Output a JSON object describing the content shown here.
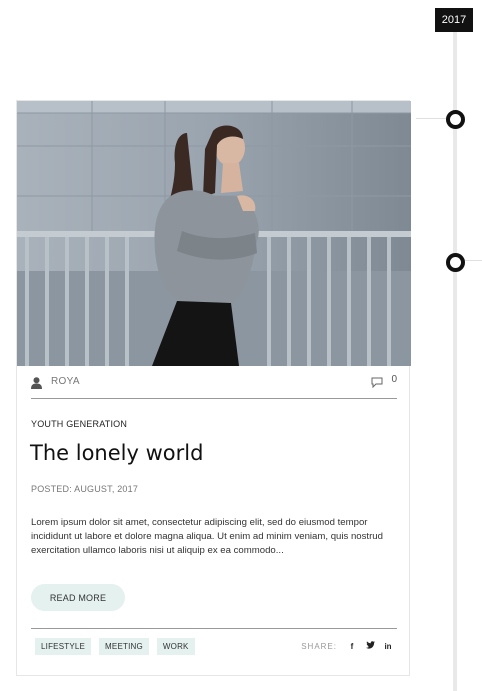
{
  "timeline": {
    "year": "2017"
  },
  "post": {
    "author": "ROYA",
    "comment_count": "0",
    "category": "YOUTH GENERATION",
    "title": "The lonely world",
    "posted": "POSTED: AUGUST, 2017",
    "excerpt": "Lorem ipsum dolor sit amet, consectetur adipiscing elit, sed do eiusmod tempor incididunt ut labore et dolore magna aliqua. Ut enim ad minim veniam, quis nostrud exercitation ullamco laboris nisi ut aliquip ex ea commodo...",
    "read_more": "READ MORE",
    "tags": [
      "LIFESTYLE",
      "MEETING",
      "WORK"
    ],
    "share_label": "SHARE:",
    "social": {
      "facebook": "f",
      "twitter": "🐦",
      "linkedin": "in"
    }
  },
  "icons": {
    "author": "user-icon",
    "comments": "comment-icon"
  },
  "colors": {
    "badge": "#111111",
    "tag_bg": "#e4f1ef",
    "node": "#111111"
  }
}
